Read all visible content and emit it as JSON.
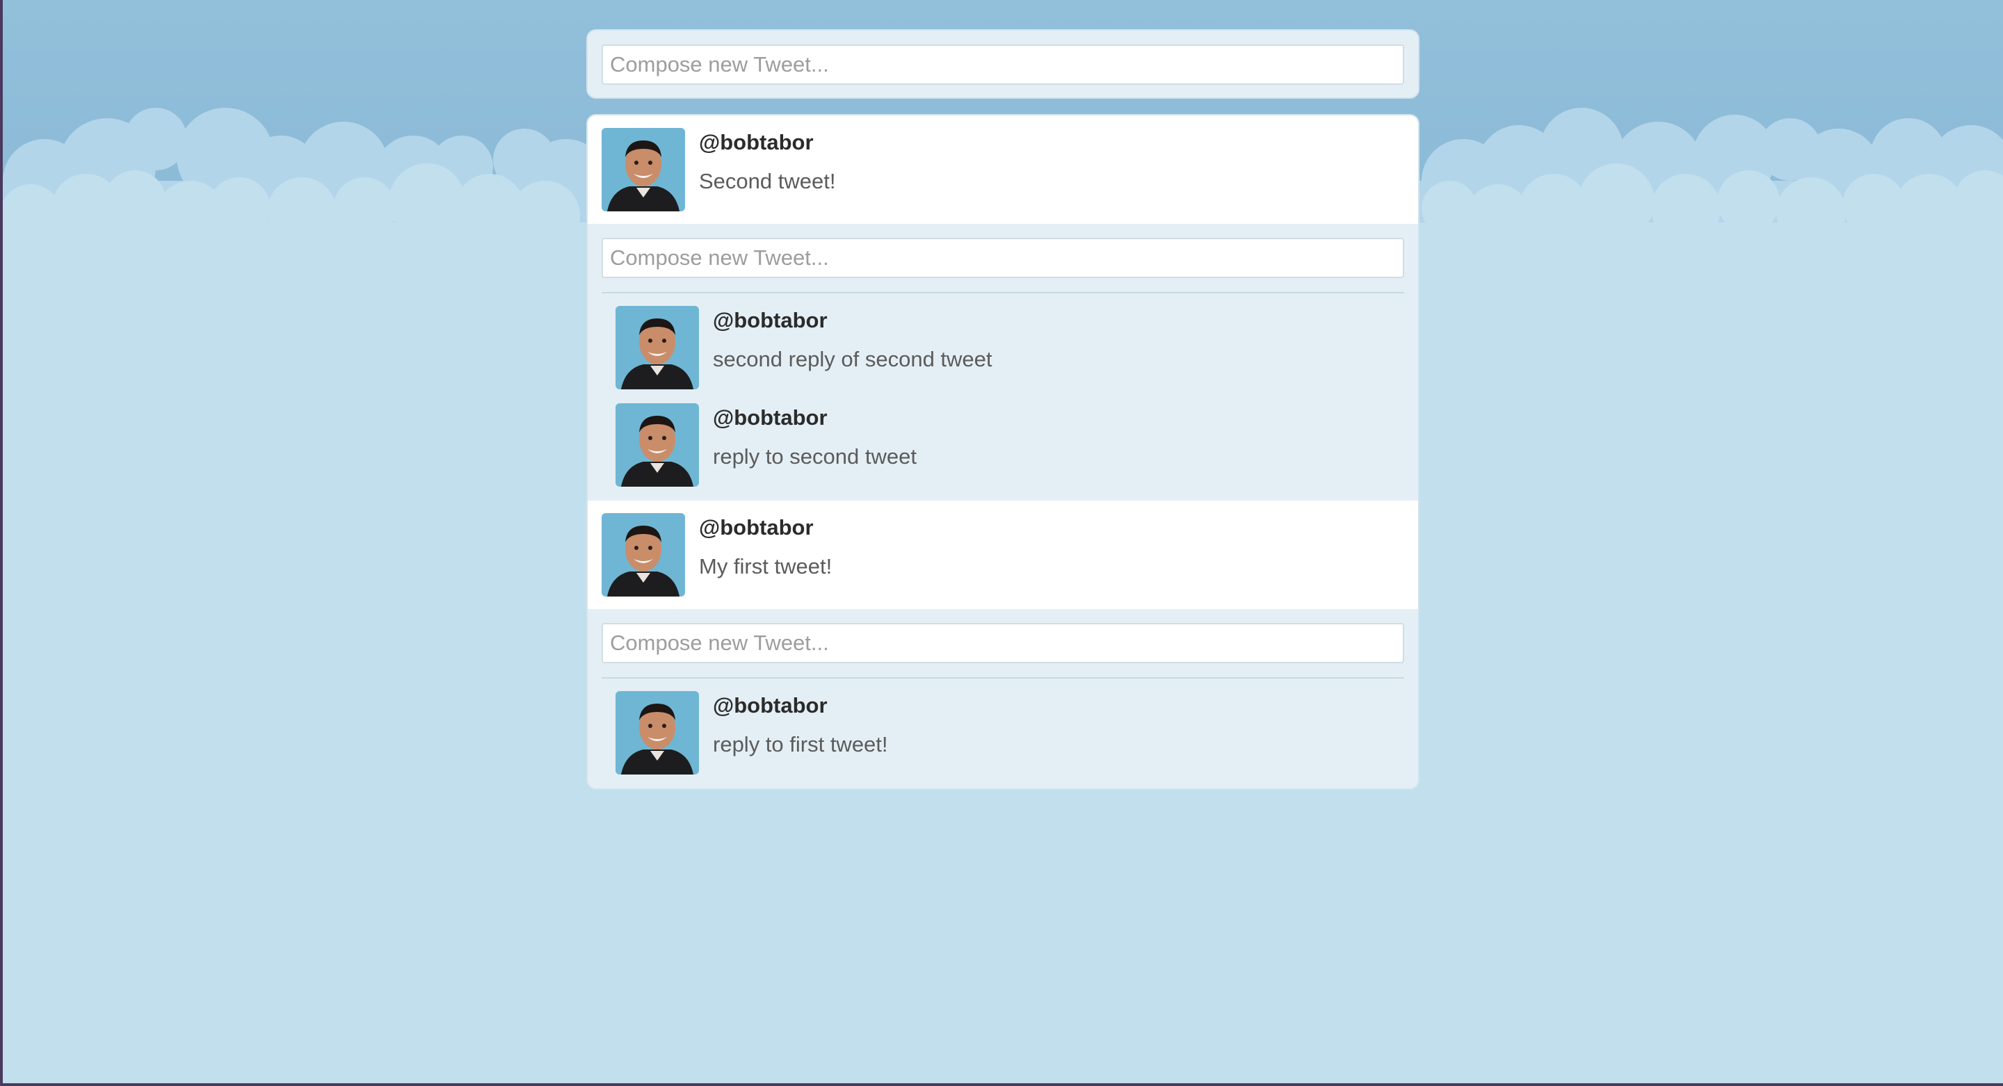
{
  "compose_placeholder": "Compose new Tweet...",
  "colors": {
    "background": "#c2dfee",
    "sky": "#8fbfda",
    "panel": "#e4eff5",
    "tweet_bg": "#ffffff"
  },
  "tweets": [
    {
      "handle": "@bobtabor",
      "text": "Second tweet!",
      "reply_placeholder": "Compose new Tweet...",
      "replies": [
        {
          "handle": "@bobtabor",
          "text": "second reply of second tweet"
        },
        {
          "handle": "@bobtabor",
          "text": "reply to second tweet"
        }
      ]
    },
    {
      "handle": "@bobtabor",
      "text": "My first tweet!",
      "reply_placeholder": "Compose new Tweet...",
      "replies": [
        {
          "handle": "@bobtabor",
          "text": "reply to first tweet!"
        }
      ]
    }
  ]
}
